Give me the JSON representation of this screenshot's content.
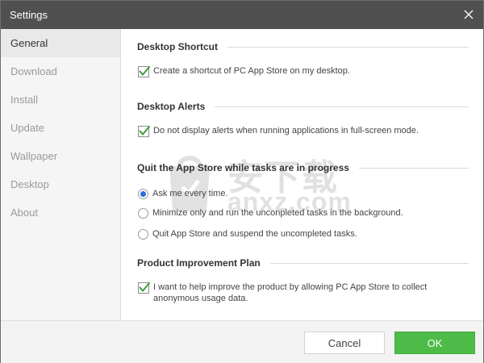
{
  "window": {
    "title": "Settings"
  },
  "sidebar": {
    "items": [
      {
        "label": "General",
        "active": true
      },
      {
        "label": "Download"
      },
      {
        "label": "Install"
      },
      {
        "label": "Update"
      },
      {
        "label": "Wallpaper"
      },
      {
        "label": "Desktop"
      },
      {
        "label": "About"
      }
    ]
  },
  "sections": {
    "desktop_shortcut": {
      "title": "Desktop Shortcut",
      "option": "Create a shortcut of PC App Store on my desktop.",
      "checked": true
    },
    "desktop_alerts": {
      "title": "Desktop Alerts",
      "option": "Do not display alerts when running applications in full-screen mode.",
      "checked": true
    },
    "quit": {
      "title": "Quit the App Store while tasks are in progress",
      "options": [
        {
          "label": "Ask me every time.",
          "selected": true
        },
        {
          "label": "Minimize only and run the unconpleted tasks in the background."
        },
        {
          "label": "Quit App Store and suspend the uncompleted tasks."
        }
      ]
    },
    "improvement": {
      "title": "Product Improvement Plan",
      "option_line1": "I want to help improve the product by allowing PC App Store to collect",
      "option_line2": "anonymous usage data.",
      "checked": true
    }
  },
  "watermark": {
    "text_cn": "安下载",
    "text_en": "anxz.com"
  },
  "footer": {
    "cancel_label": "Cancel",
    "ok_label": "OK"
  },
  "colors": {
    "titlebar": "#505050",
    "ok_button": "#4cbb47",
    "check": "#3d9a3a",
    "radio": "#2a6fdb"
  }
}
